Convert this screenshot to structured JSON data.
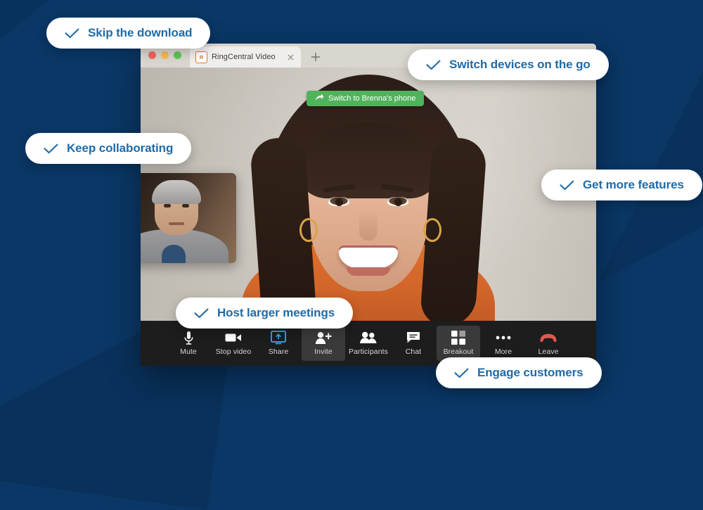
{
  "theme": {
    "background": "#0a3766",
    "pill_text": "#1f6ba8",
    "banner_green": "#4fb35b",
    "toolbar_bg": "#1d1d1d",
    "share_accent": "#2f9fe0",
    "leave_red": "#e0584f"
  },
  "browser": {
    "tab": {
      "title": "RingCentral Video",
      "favicon_letter": "R",
      "close_icon": "close-icon",
      "newtab_icon": "plus-icon"
    },
    "traffic_lights": [
      "close",
      "minimize",
      "maximize"
    ]
  },
  "meeting": {
    "switch_banner": {
      "icon": "share-arrow-icon",
      "text": "Switch to Brenna's phone"
    },
    "self_view_label": "self-view-thumbnail",
    "toolbar": [
      {
        "label": "Mute",
        "icon": "microphone-icon",
        "active": false
      },
      {
        "label": "Stop video",
        "icon": "camera-icon",
        "active": false
      },
      {
        "label": "Share",
        "icon": "screen-share-icon",
        "active": false
      },
      {
        "label": "Invite",
        "icon": "person-add-icon",
        "active": true
      },
      {
        "label": "Participants",
        "icon": "people-icon",
        "active": false
      },
      {
        "label": "Chat",
        "icon": "chat-bubble-icon",
        "active": false
      },
      {
        "label": "Breakout",
        "icon": "grid-icon",
        "active": true
      },
      {
        "label": "More",
        "icon": "ellipsis-icon",
        "active": false
      },
      {
        "label": "Leave",
        "icon": "hangup-icon",
        "active": false
      }
    ]
  },
  "pills": [
    {
      "text": "Skip the download",
      "icon": "check-icon"
    },
    {
      "text": "Switch devices on the go",
      "icon": "check-icon"
    },
    {
      "text": "Keep collaborating",
      "icon": "check-icon"
    },
    {
      "text": "Get more features",
      "icon": "check-icon"
    },
    {
      "text": "Host larger meetings",
      "icon": "check-icon"
    },
    {
      "text": "Engage customers",
      "icon": "check-icon"
    }
  ]
}
